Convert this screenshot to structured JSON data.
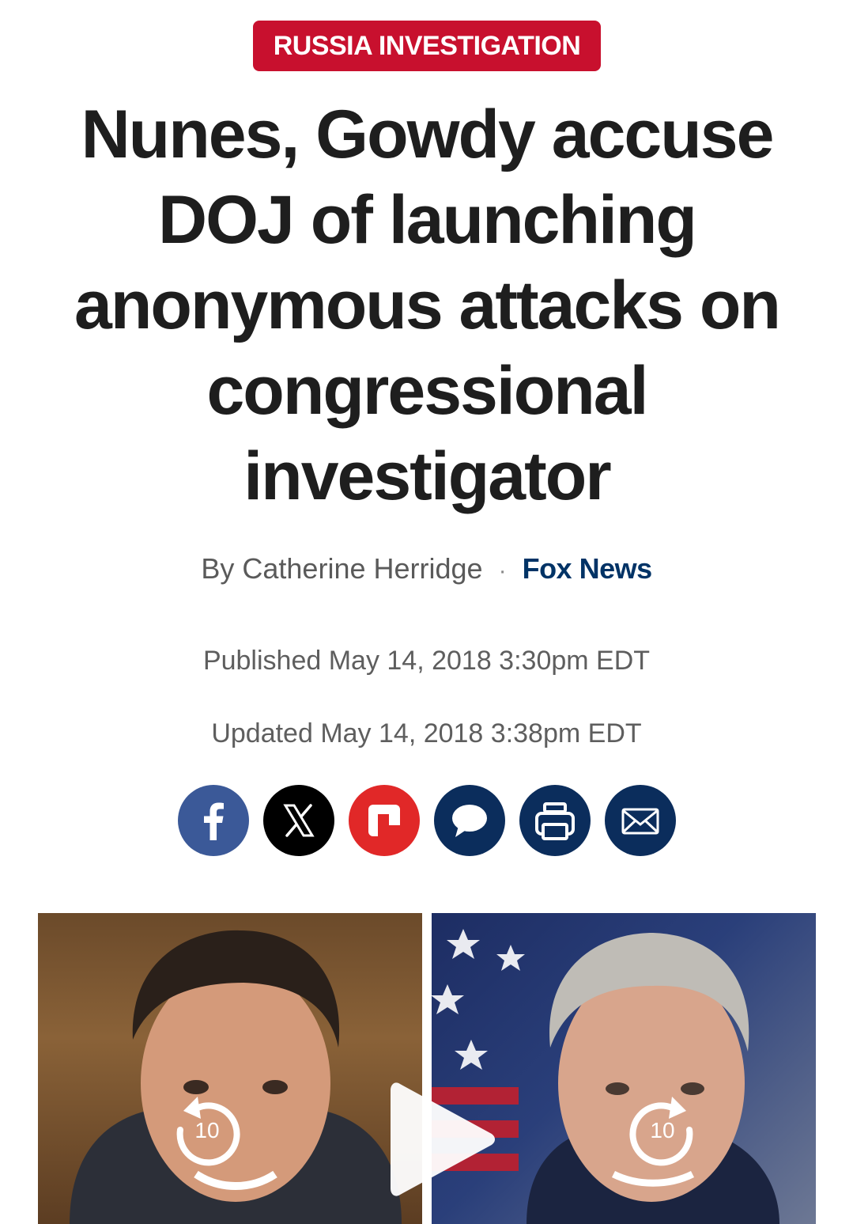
{
  "article": {
    "category": "RUSSIA INVESTIGATION",
    "headline": "Nunes, Gowdy accuse DOJ of launching anonymous attacks on congressional investigator",
    "byline": {
      "author": "By Catherine Herridge",
      "separator": "·",
      "source": "Fox News"
    },
    "published": "Published May 14, 2018 3:30pm EDT",
    "updated": "Updated May 14, 2018 3:38pm EDT"
  },
  "share": {
    "buttons": [
      {
        "icon": "facebook-icon",
        "color": "#3b5998"
      },
      {
        "icon": "x-icon",
        "color": "#000000"
      },
      {
        "icon": "flipboard-icon",
        "color": "#e12828"
      },
      {
        "icon": "comment-icon",
        "color": "#0b2d5c"
      },
      {
        "icon": "print-icon",
        "color": "#0b2d5c"
      },
      {
        "icon": "email-icon",
        "color": "#0b2d5c"
      }
    ]
  },
  "video": {
    "rewind_seconds": "10",
    "forward_seconds": "10"
  },
  "colors": {
    "badge": "#c8102e",
    "brand_navy": "#003366"
  }
}
